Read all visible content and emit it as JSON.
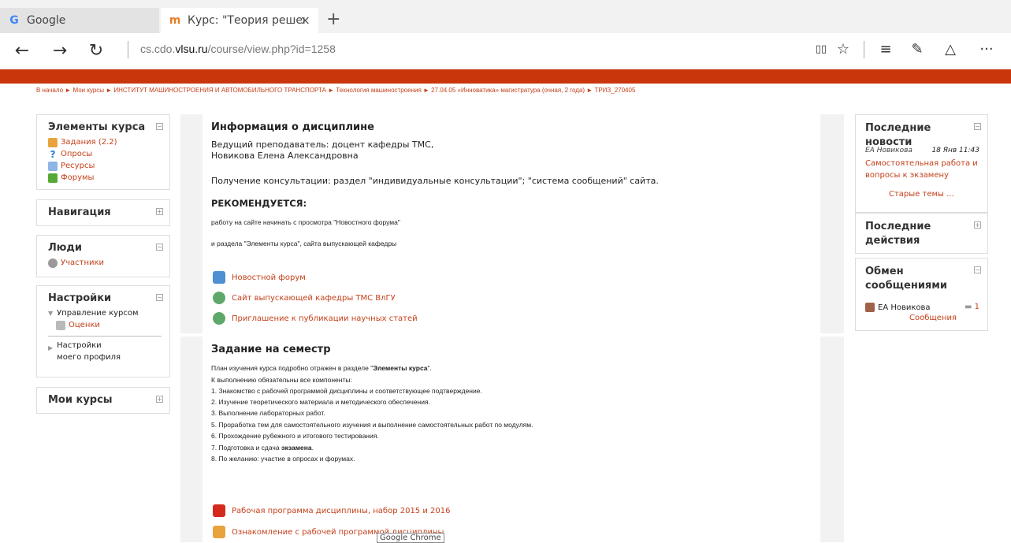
{
  "browser": {
    "tabs": [
      {
        "title": "Google",
        "icon": "G"
      },
      {
        "title": "Курс: \"Теория решения",
        "icon": "m"
      }
    ],
    "new_tab": "+",
    "close": "×",
    "url_host": "cs.cdo.",
    "url_domain": "vlsu.ru",
    "url_path": "/course/view.php?id=1258",
    "nav": {
      "back": "←",
      "forward": "→",
      "refresh": "↻"
    },
    "toolbar": {
      "reading": "▯▯",
      "favorite": "☆",
      "hub": "≡",
      "note": "✎",
      "share": "△",
      "more": "···"
    }
  },
  "breadcrumb": "В начало ► Мои курсы ► ИНСТИТУТ МАШИНОСТРОЕНИЯ И АВТОМОБИЛЬНОГО ТРАНСПОРТА ► Технология машиностроения ► 27.04.05 «Инноватика» магистратура (очная, 2 года) ► ТРИЗ_270405",
  "left": {
    "elements": {
      "title": "Элементы курса",
      "items": [
        "Задания (2.2)",
        "Опросы",
        "Ресурсы",
        "Форумы"
      ]
    },
    "navigation": {
      "title": "Навигация"
    },
    "people": {
      "title": "Люди",
      "items": [
        "Участники"
      ]
    },
    "settings": {
      "title": "Настройки",
      "course_admin": "Управление курсом",
      "grades": "Оценки",
      "profile": "Настройки моего профиля"
    },
    "mycourses": {
      "title": "Мои курсы"
    }
  },
  "main": {
    "section1": {
      "title": "Информация о дисциплине",
      "teacher1": "Ведущий преподаватель: доцент кафедры ТМС,",
      "teacher2": "Новикова Елена Александровна",
      "consult": "Получение консультации: раздел \"индивидуальные консультации\"; \"система сообщений\" сайта.",
      "recommend": "РЕКОМЕНДУЕТСЯ:",
      "rec1": "работу на сайте начинать с просмотра \"Новостного форума\"",
      "rec2": "и раздела \"Элементы курса\", сайта выпускающей кафедры",
      "links": [
        "Новостной форум",
        "Сайт выпускающей кафедры ТМС ВлГУ",
        "Приглашение к публикации научных статей"
      ]
    },
    "section2": {
      "title": "Задание на семестр",
      "plan_pre": "План изучения курса подробно отражен в разделе \"",
      "plan_bold": "Элементы курса",
      "plan_post": "\".",
      "intro": "К выполнению обязательны все компоненты:",
      "items": [
        "1. Знакомство с рабочей программой дисциплины и соответствующее подтверждение.",
        "2. Изучение теоретического материала и методического обеспечения.",
        "3. Выполнение лабораторных работ.",
        "5. Проработка тем для самостоятельного изучения и выполнение самостоятельных работ по модулям.",
        "6. Прохождение рубежного и итогового тестирования.",
        "7. Подготовка и сдача ",
        "8. По желанию: участие в опросах и форумах."
      ],
      "exam": "экзамена",
      "links": [
        "Рабочая программа дисциплины, набор 2015 и 2016",
        "Ознакомление с рабочей программой дисциплины"
      ]
    }
  },
  "right": {
    "news": {
      "title": "Последние новости",
      "author": "ЕА Новикова",
      "date": "18 Янв 11:43",
      "post": "Самостоятельная работа и вопросы к экзамену",
      "older": "Старые темы ..."
    },
    "recent": {
      "title": "Последние действия"
    },
    "messages": {
      "title": "Обмен сообщениями",
      "user": "ЕА Новикова",
      "count": "1",
      "link": "Сообщения"
    }
  },
  "tooltip": "Google Chrome",
  "colors": {
    "accent": "#c4401a",
    "bar": "#c9360c"
  }
}
